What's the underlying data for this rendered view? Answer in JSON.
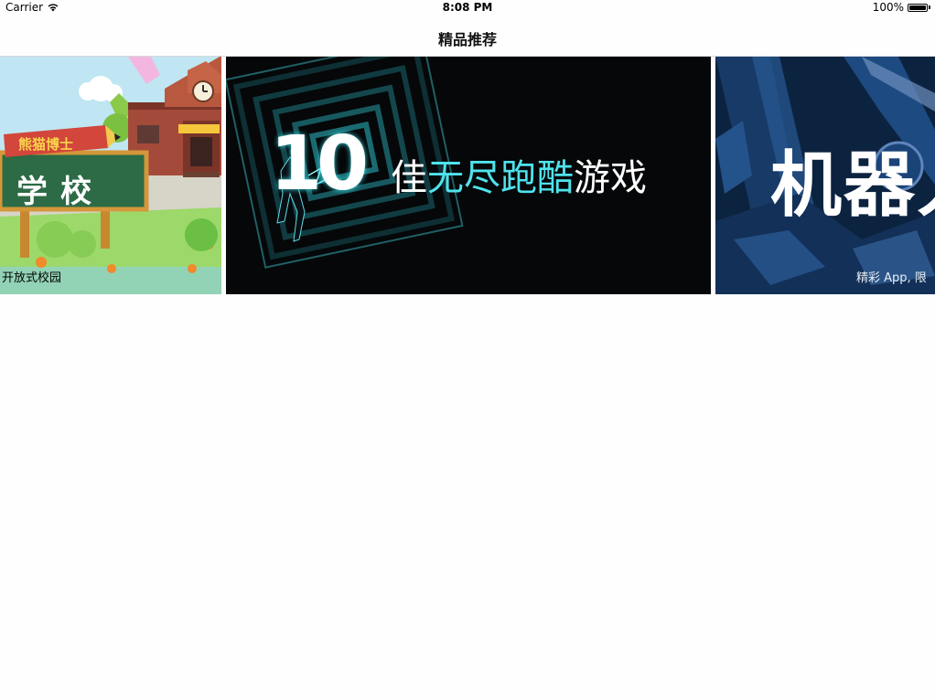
{
  "status_bar": {
    "carrier": "Carrier",
    "time": "8:08 PM",
    "battery": "100%",
    "icons": [
      "wifi-icon",
      "battery-icon"
    ]
  },
  "nav": {
    "title": "精品推荐"
  },
  "carousel": {
    "cards": [
      {
        "pencil_text": "熊猫博士",
        "board_text": "学校",
        "caption": "开放式校园",
        "bg_color": "#bfe6f2"
      },
      {
        "big_number": "10",
        "headline_white_1": "佳",
        "headline_cyan": "无尽跑酷",
        "headline_white_2": "游戏",
        "bg_color": "#050709",
        "accent_color": "#4fe3ec"
      },
      {
        "title": "机器人",
        "caption": "精彩 App, 限",
        "bg_color": "#0c2340"
      }
    ]
  }
}
